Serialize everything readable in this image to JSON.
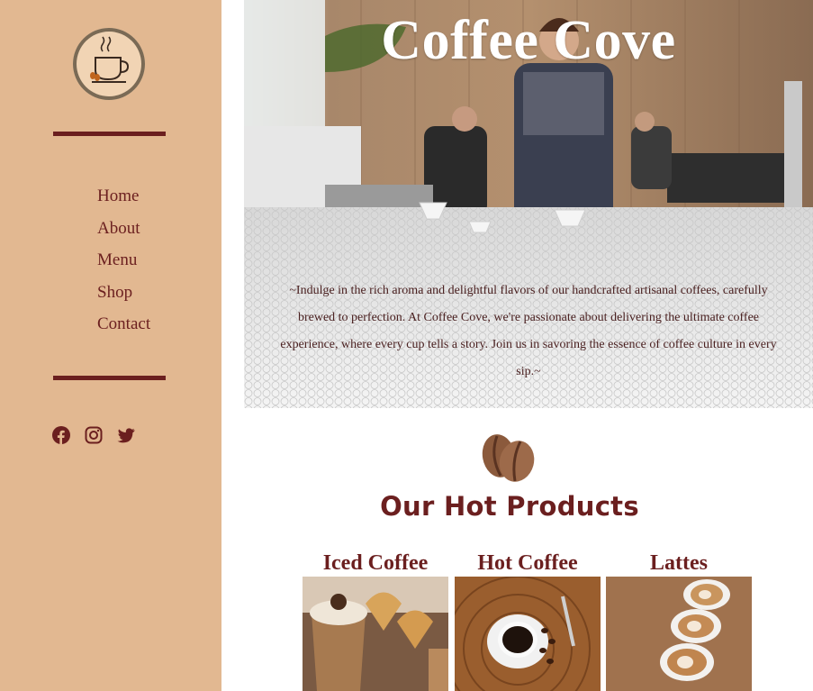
{
  "sidebar": {
    "nav": [
      "Home",
      "About",
      "Menu",
      "Shop",
      "Contact"
    ],
    "social": [
      "facebook-icon",
      "instagram-icon",
      "twitter-icon"
    ]
  },
  "hero": {
    "title": "Coffee Cove",
    "text": "~Indulge in the rich aroma and delightful flavors of our handcrafted artisanal coffees, carefully brewed to perfection. At Coffee Cove, we're passionate about delivering the ultimate coffee experience, where every cup tells a story. Join us in savoring the essence of coffee culture in every sip.~"
  },
  "products": {
    "title": "Our Hot Products",
    "items": [
      {
        "name": "Iced Coffee"
      },
      {
        "name": "Hot Coffee"
      },
      {
        "name": "Lattes"
      }
    ]
  },
  "colors": {
    "sidebar_bg": "#e2b891",
    "accent": "#6b1f1f"
  }
}
